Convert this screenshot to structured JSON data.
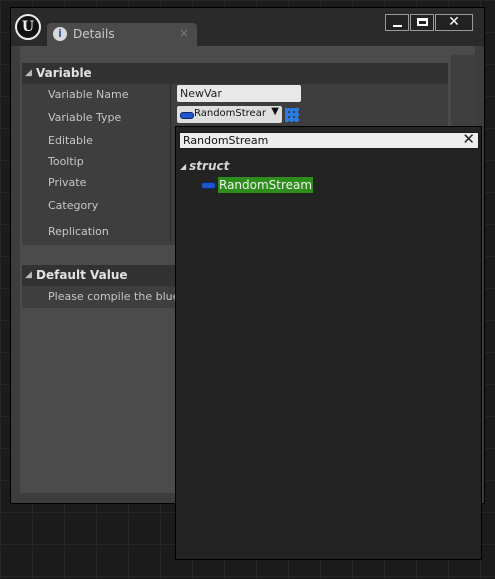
{
  "window": {
    "tab": {
      "title": "Details",
      "icon": "details-magnifier-icon",
      "close_glyph": "×"
    },
    "controls": {
      "minimize": "minimize-icon",
      "maximize": "maximize-icon",
      "close": "close-icon"
    }
  },
  "details": {
    "variable_section": {
      "title": "Variable",
      "properties": {
        "variable_name": "Variable Name",
        "variable_type": "Variable Type",
        "editable": "Editable",
        "tooltip": "Tooltip",
        "private": "Private",
        "category": "Category",
        "replication": "Replication"
      },
      "variable_name_value": "NewVar",
      "variable_type_value": "RandomStream"
    },
    "default_section": {
      "title": "Default Value",
      "message": "Please compile the bluep"
    }
  },
  "type_picker": {
    "search_value": "RandomStream",
    "clear_glyph": "✕",
    "category": "struct",
    "result": "RandomStream"
  },
  "colors": {
    "struct_pin": "#1e55c8",
    "selection_highlight": "#2d8e1b",
    "grid_icon": "#2b7be0"
  }
}
